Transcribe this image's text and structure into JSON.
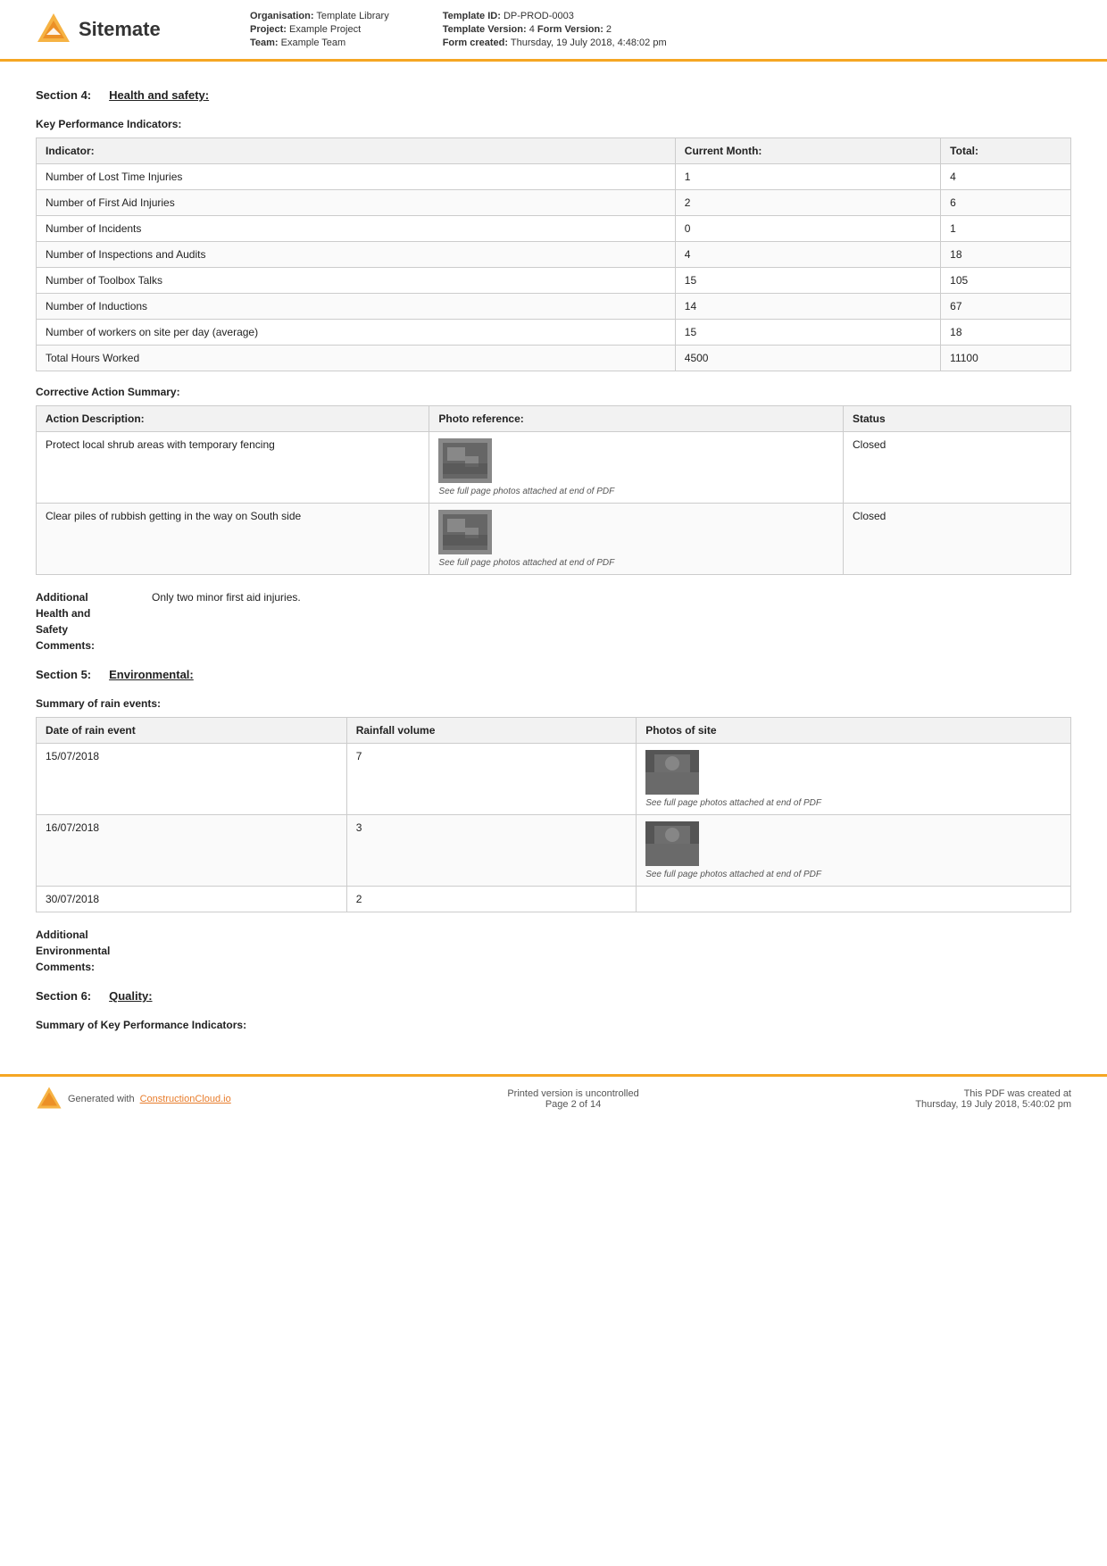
{
  "header": {
    "logo_text": "Sitemate",
    "org_label": "Organisation:",
    "org_value": "Template Library",
    "project_label": "Project:",
    "project_value": "Example Project",
    "team_label": "Team:",
    "team_value": "Example Team",
    "template_id_label": "Template ID:",
    "template_id_value": "DP-PROD-0003",
    "template_version_label": "Template Version:",
    "template_version_value": "4",
    "form_version_label": "Form Version:",
    "form_version_value": "2",
    "form_created_label": "Form created:",
    "form_created_value": "Thursday, 19 July 2018, 4:48:02 pm"
  },
  "section4": {
    "label": "Section 4:",
    "title": "Health and safety:"
  },
  "kpi_section": {
    "title": "Key Performance Indicators:",
    "headers": [
      "Indicator:",
      "Current Month:",
      "Total:"
    ],
    "rows": [
      {
        "indicator": "Number of Lost Time Injuries",
        "current_month": "1",
        "total": "4"
      },
      {
        "indicator": "Number of First Aid Injuries",
        "current_month": "2",
        "total": "6"
      },
      {
        "indicator": "Number of Incidents",
        "current_month": "0",
        "total": "1"
      },
      {
        "indicator": "Number of Inspections and Audits",
        "current_month": "4",
        "total": "18"
      },
      {
        "indicator": "Number of Toolbox Talks",
        "current_month": "15",
        "total": "105"
      },
      {
        "indicator": "Number of Inductions",
        "current_month": "14",
        "total": "67"
      },
      {
        "indicator": "Number of workers on site per day (average)",
        "current_month": "15",
        "total": "18"
      },
      {
        "indicator": "Total Hours Worked",
        "current_month": "4500",
        "total": "11100"
      }
    ]
  },
  "corrective_action": {
    "title": "Corrective Action Summary:",
    "headers": [
      "Action Description:",
      "Photo reference:",
      "Status"
    ],
    "rows": [
      {
        "description": "Protect local shrub areas with temporary fencing",
        "photo_caption": "See full page photos attached at end of PDF",
        "status": "Closed"
      },
      {
        "description": "Clear piles of rubbish getting in the way on South side",
        "photo_caption": "See full page photos attached at end of PDF",
        "status": "Closed"
      }
    ]
  },
  "hs_comments": {
    "label": "Additional\nHealth and\nSafety\nComments:",
    "value": "Only two minor first aid injuries."
  },
  "section5": {
    "label": "Section 5:",
    "title": "Environmental:"
  },
  "rain_events": {
    "title": "Summary of rain events:",
    "headers": [
      "Date of rain event",
      "Rainfall volume",
      "Photos of site"
    ],
    "rows": [
      {
        "date": "15/07/2018",
        "volume": "7",
        "photo_caption": "See full page photos attached at end of PDF"
      },
      {
        "date": "16/07/2018",
        "volume": "3",
        "photo_caption": "See full page photos attached at end of PDF"
      },
      {
        "date": "30/07/2018",
        "volume": "2",
        "photo_caption": ""
      }
    ]
  },
  "env_comments": {
    "label": "Additional\nEnvironmental\nComments:",
    "value": ""
  },
  "section6": {
    "label": "Section 6:",
    "title": "Quality:"
  },
  "quality_kpi": {
    "title": "Summary of Key Performance Indicators:"
  },
  "footer": {
    "generated_text": "Generated with ",
    "link_text": "ConstructionCloud.io",
    "center_text": "Printed version is uncontrolled\nPage 2 of 14",
    "right_text": "This PDF was created at\nThursday, 19 July 2018, 5:40:02 pm"
  }
}
